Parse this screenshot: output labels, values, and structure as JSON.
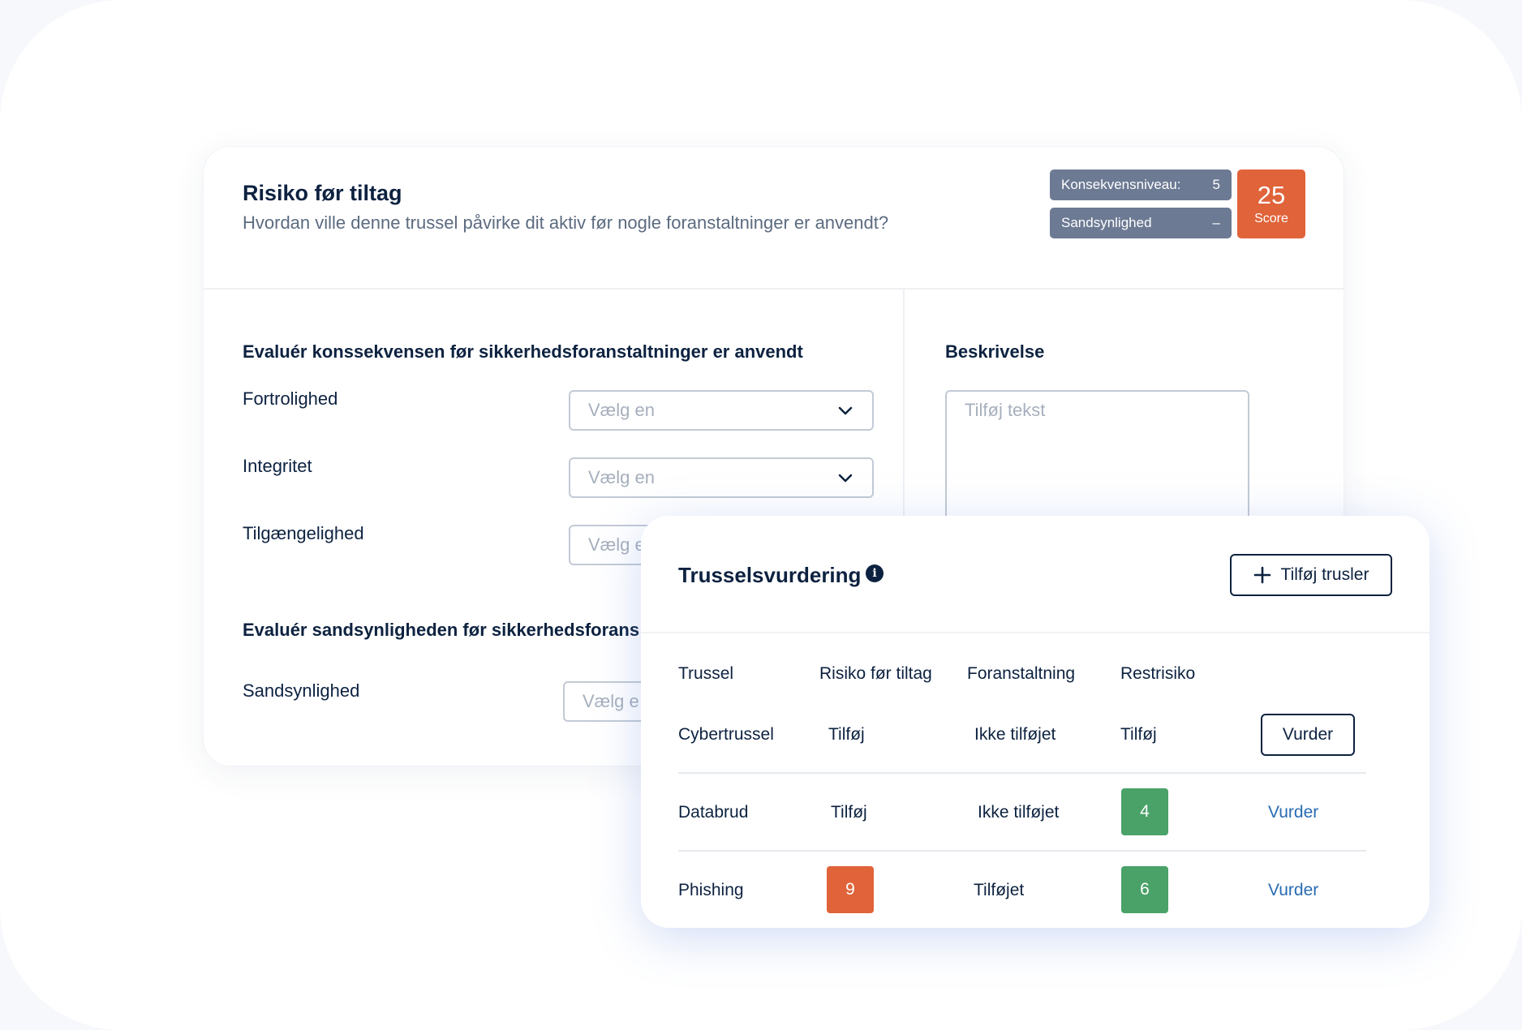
{
  "risk": {
    "title": "Risiko før tiltag",
    "subtitle": "Hvordan ville denne trussel påvirke dit aktiv før nogle foranstaltninger er anvendt?",
    "konsekvens_label": "Konsekvensniveau:",
    "konsekvens_value": "5",
    "sandsynlighed_label": "Sandsynlighed",
    "sandsynlighed_value": "–",
    "score_value": "25",
    "score_label": "Score",
    "section_konsekvens": "Evaluér konssekvensen før sikkerhedsforanstaltninger er anvendt",
    "section_sandsynlighed": "Evaluér sandsynligheden før sikkerhedsforans",
    "fields": [
      {
        "label": "Fortrolighed",
        "placeholder": "Vælg en"
      },
      {
        "label": "Integritet",
        "placeholder": "Vælg en"
      },
      {
        "label": "Tilgængelighed",
        "placeholder": "Vælg e"
      }
    ],
    "sandsynlighed_field": {
      "label": "Sandsynlighed",
      "placeholder": "Vælg e"
    },
    "beskrivelse_label": "Beskrivelse",
    "beskrivelse_placeholder": "Tilføj tekst"
  },
  "threat": {
    "title": "Trusselsvurdering",
    "info_icon": "i",
    "add_button": "Tilføj trusler",
    "headers": [
      "Trussel",
      "Risiko før tiltag",
      "Foranstaltning",
      "Restrisiko"
    ],
    "rows": [
      {
        "name": "Cybertrussel",
        "risk": "Tilføj",
        "measure": "Ikke tilføjet",
        "rest": "Tilføj",
        "action": "Vurder"
      },
      {
        "name": "Databrud",
        "risk": "Tilføj",
        "measure": "Ikke tilføjet",
        "rest": "4",
        "rest_color": "#4aa269",
        "action": "Vurder"
      },
      {
        "name": "Phishing",
        "risk": "9",
        "risk_color": "#e0633a",
        "measure": "Tilføjet",
        "rest": "6",
        "rest_color": "#4aa269",
        "action": "Vurder"
      }
    ]
  }
}
